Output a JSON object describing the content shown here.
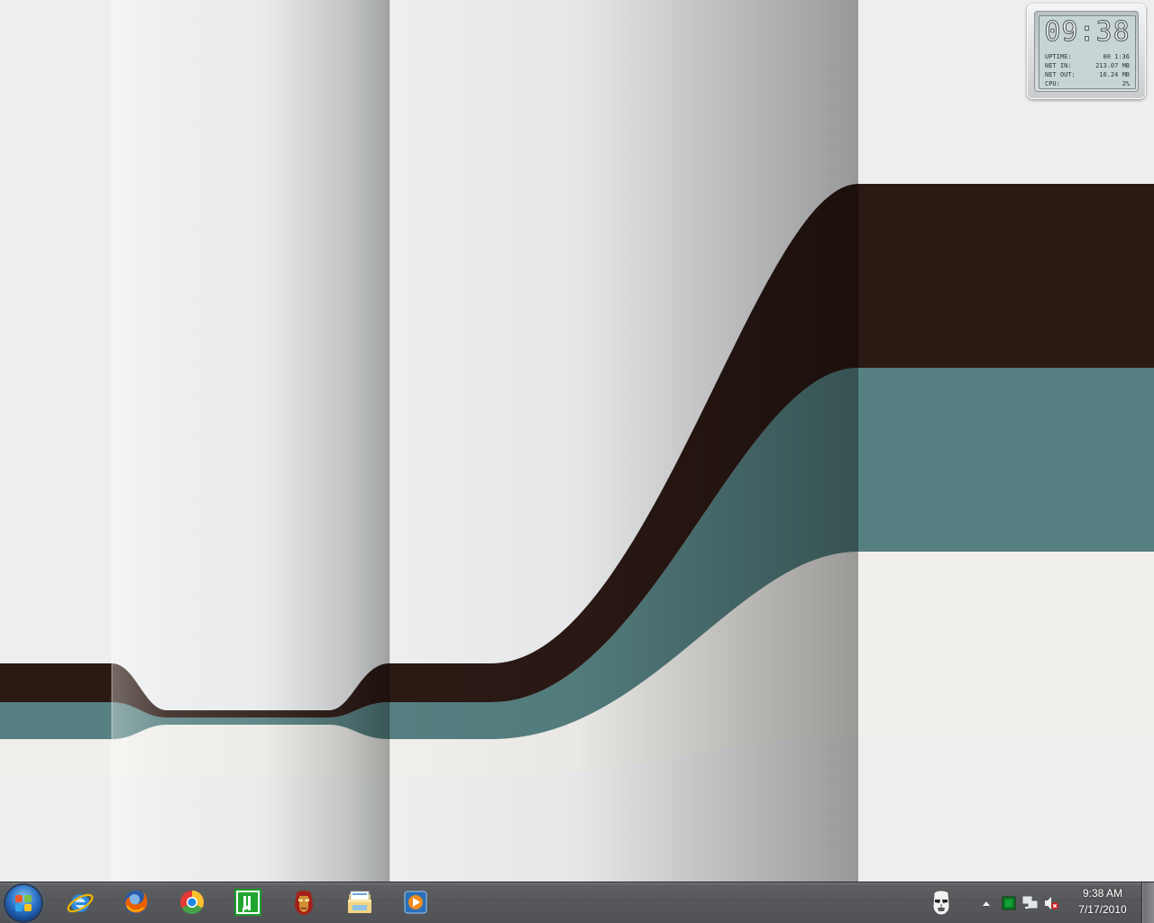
{
  "gadget": {
    "time": "09:38",
    "stats": [
      {
        "label": "UPTIME:",
        "value": "00 1:36"
      },
      {
        "label": "NET IN:",
        "value": "213.07 MB"
      },
      {
        "label": "NET OUT:",
        "value": "16.24 MB"
      },
      {
        "label": "CPU:",
        "value": "2%"
      }
    ]
  },
  "taskbar": {
    "start_button": "start-orb",
    "pinned_apps": [
      {
        "name": "Internet Explorer",
        "icon": "internet-explorer-icon"
      },
      {
        "name": "Firefox",
        "icon": "firefox-icon"
      },
      {
        "name": "Google Chrome",
        "icon": "chrome-icon"
      },
      {
        "name": "uTorrent",
        "icon": "utorrent-icon"
      },
      {
        "name": "Iron Man app",
        "icon": "ironman-icon"
      },
      {
        "name": "Windows Explorer",
        "icon": "file-explorer-icon"
      },
      {
        "name": "Windows Media Player",
        "icon": "media-player-icon"
      }
    ],
    "tray": {
      "icons": [
        "stormtrooper-icon",
        "show-hidden-icons-arrow",
        "green-status-icon",
        "network-icon",
        "volume-muted-icon"
      ],
      "time": "9:38 AM",
      "date": "7/17/2010"
    }
  },
  "colors": {
    "stripe_dark": "#2b1914",
    "stripe_teal": "#557f80",
    "stripe_cream": "#f1efeb",
    "desktop_bg": "#eceef0",
    "taskbar": "#505255"
  }
}
